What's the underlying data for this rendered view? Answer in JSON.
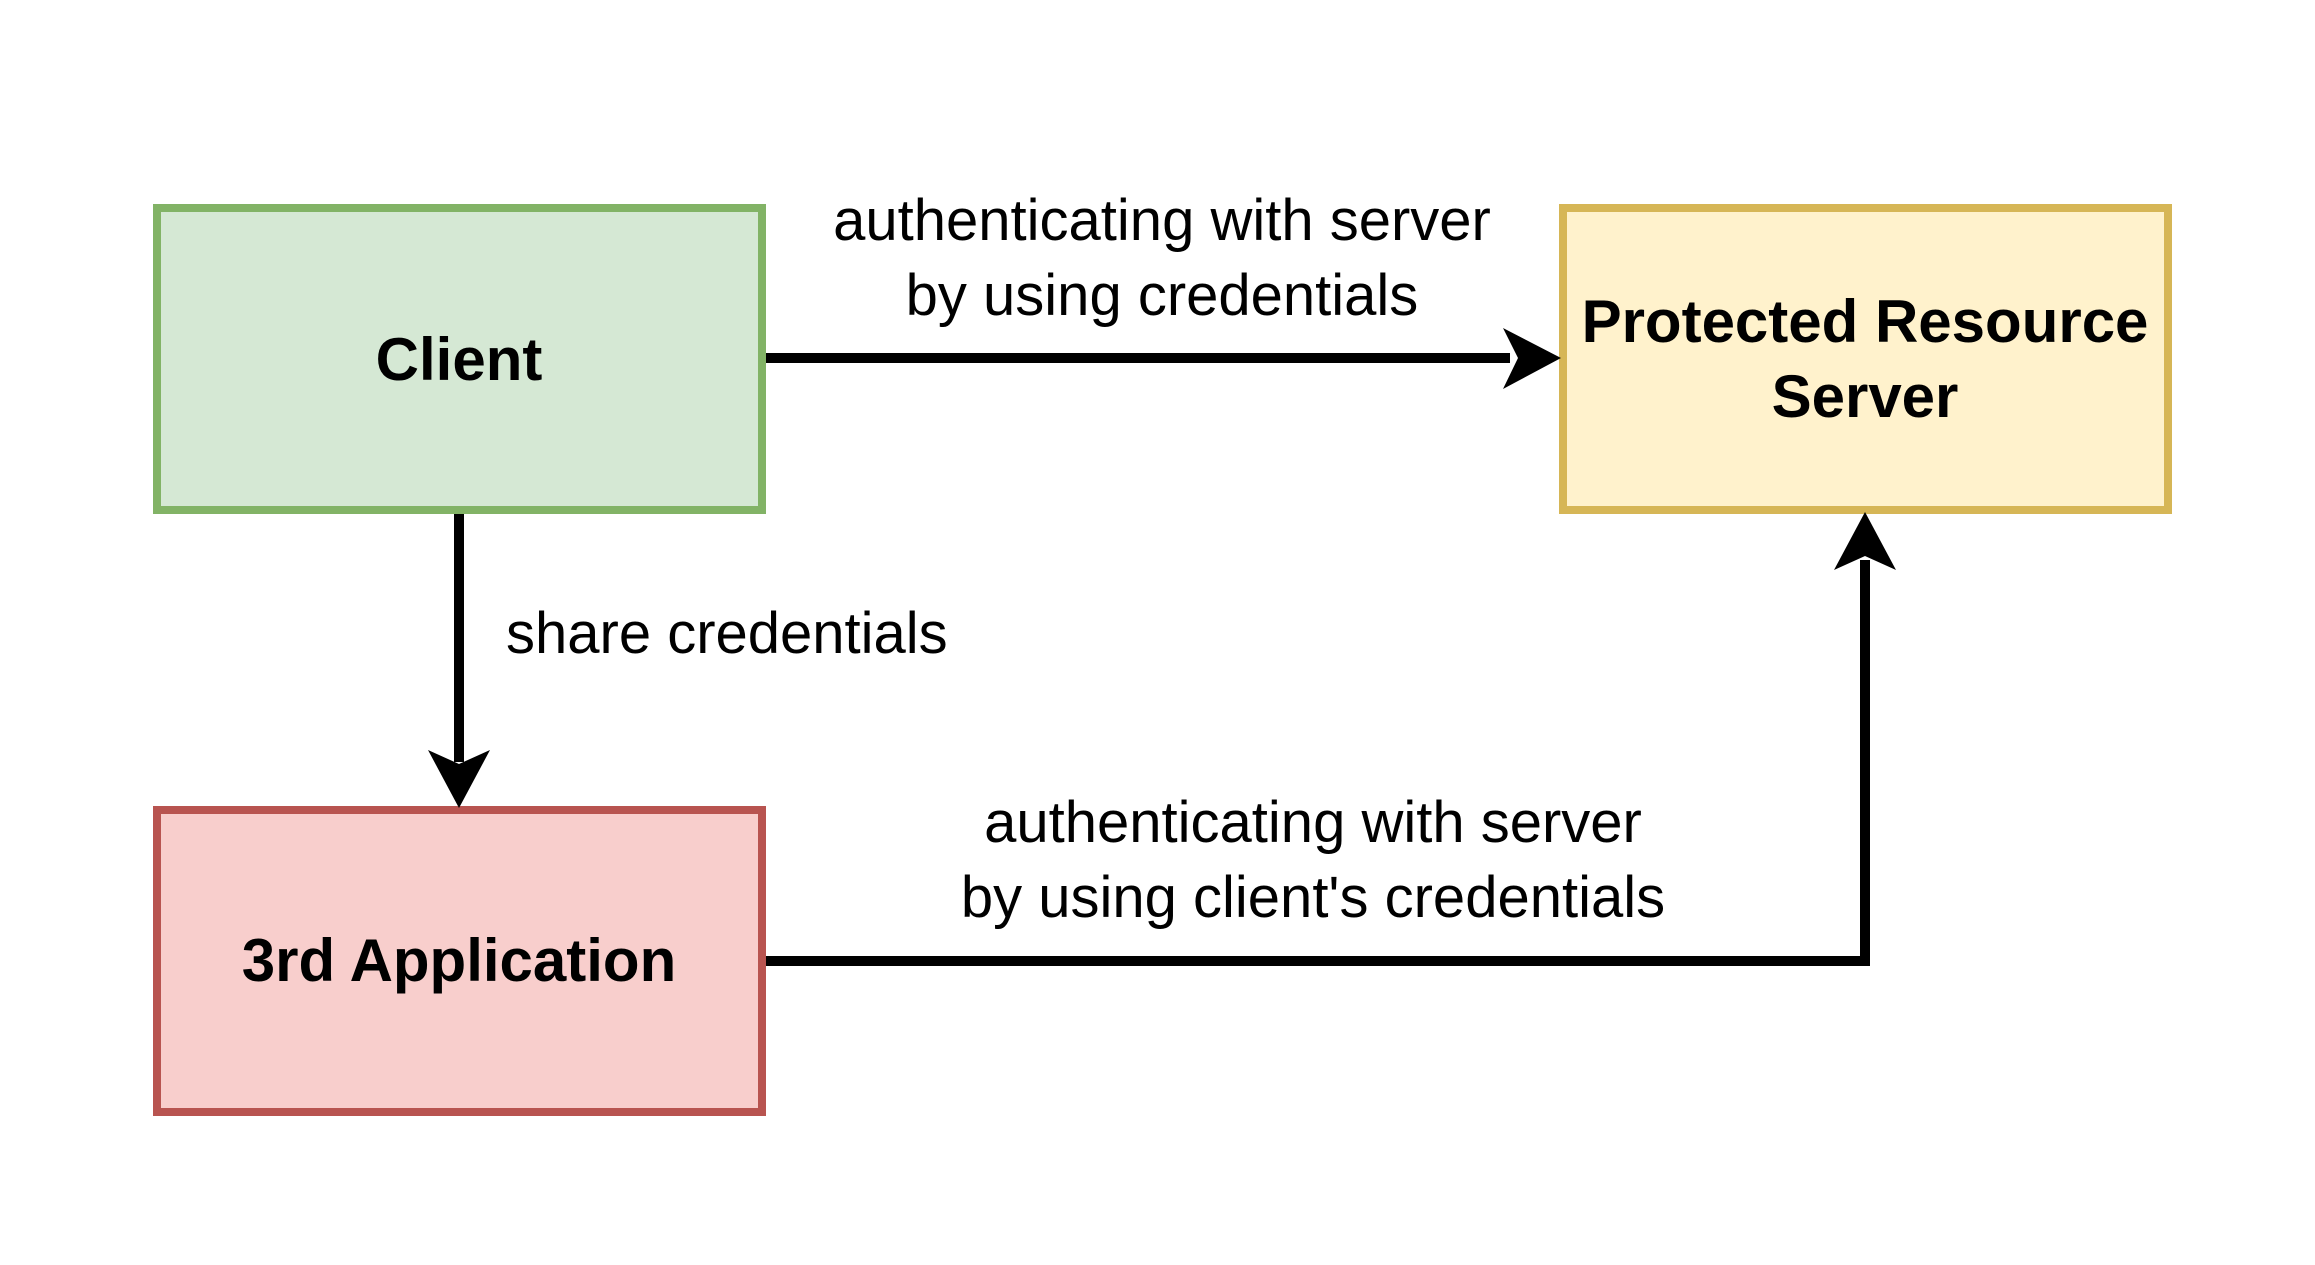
{
  "nodes": {
    "client": {
      "label": "Client",
      "fill": "#d5e8d4",
      "stroke": "#82b366"
    },
    "server": {
      "label_line1": "Protected Resource",
      "label_line2": "Server",
      "fill": "#fff2cc",
      "stroke": "#d6b656"
    },
    "third_app": {
      "label": "3rd Application",
      "fill": "#f8cecc",
      "stroke": "#b85450"
    }
  },
  "edges": {
    "client_to_server": {
      "label_line1": "authenticating with server",
      "label_line2": "by using credentials"
    },
    "client_to_third": {
      "label": "share credentials"
    },
    "third_to_server": {
      "label_line1": "authenticating with server",
      "label_line2": "by using client's credentials"
    }
  },
  "colors": {
    "connector": "#000000",
    "text": "#000000"
  }
}
